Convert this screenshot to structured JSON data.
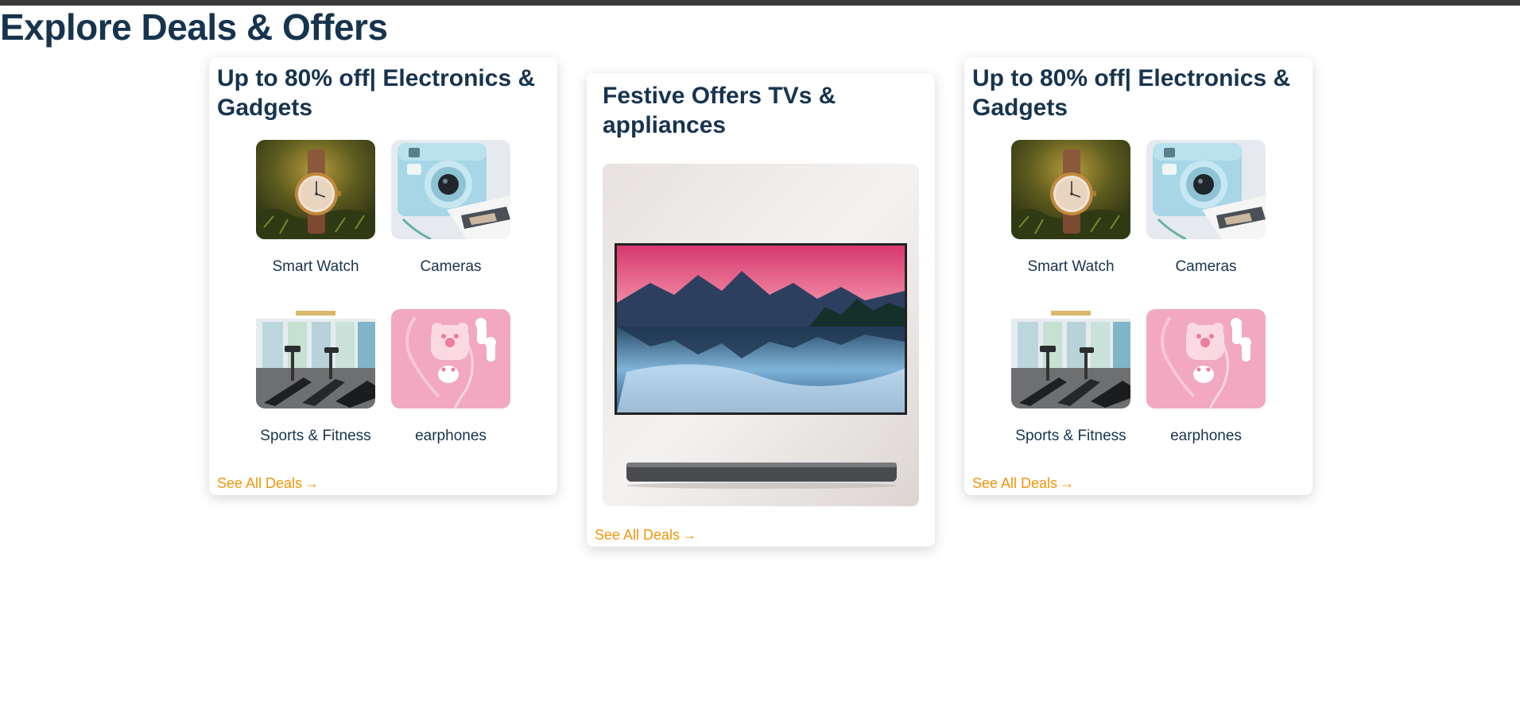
{
  "page": {
    "title": "Explore Deals & Offers"
  },
  "cards": [
    {
      "title": "Up to 80% off| Electronics & Gadgets",
      "items": [
        {
          "label": "Smart Watch",
          "icon": "smart-watch-image"
        },
        {
          "label": "Cameras",
          "icon": "camera-image"
        },
        {
          "label": "Sports & Fitness",
          "icon": "gym-treadmill-image"
        },
        {
          "label": "earphones",
          "icon": "earphones-case-image"
        }
      ],
      "link": "See All Deals"
    },
    {
      "title": "Festive Offers TVs & appliances",
      "image": "wall-tv-image",
      "link": "See All Deals"
    },
    {
      "title": "Up to 80% off| Electronics & Gadgets",
      "items": [
        {
          "label": "Smart Watch",
          "icon": "smart-watch-image"
        },
        {
          "label": "Cameras",
          "icon": "camera-image"
        },
        {
          "label": "Sports & Fitness",
          "icon": "gym-treadmill-image"
        },
        {
          "label": "earphones",
          "icon": "earphones-case-image"
        }
      ],
      "link": "See All Deals"
    }
  ],
  "colors": {
    "heading": "#17344f",
    "link": "#f0960b",
    "topbar": "#3a3a3a"
  },
  "icons": {
    "link_arrow": "arrow-right-icon"
  }
}
